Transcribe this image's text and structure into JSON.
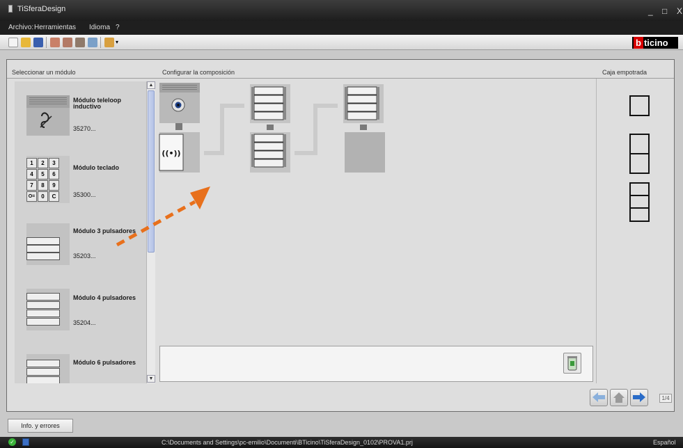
{
  "window": {
    "title": "TiSferaDesign",
    "controls": {
      "minimize": "_",
      "maximize": "□",
      "close": "X"
    }
  },
  "menu": [
    "Archivo:",
    "Herramientas",
    "Idioma",
    "?"
  ],
  "logo": {
    "prefix": "b",
    "rest": "ticino"
  },
  "headers": {
    "left": "Seleccionar un módulo",
    "center": "Configurar la composición",
    "right": "Caja empotrada"
  },
  "modules": [
    {
      "name": "Módulo teleloop inductivo",
      "code": "35270..."
    },
    {
      "name": "Módulo teclado",
      "code": "35300..."
    },
    {
      "name": "Módulo 3 pulsadores",
      "code": "35203..."
    },
    {
      "name": "Módulo 4 pulsadores",
      "code": "35204..."
    },
    {
      "name": "Módulo 6 pulsadores",
      "code": ""
    }
  ],
  "keypad": [
    "1",
    "2",
    "3",
    "4",
    "5",
    "6",
    "7",
    "8",
    "9",
    "O=",
    "0",
    "C"
  ],
  "page_indicator": "1/4",
  "info_button": "Info. y errores",
  "status": {
    "path": "C:\\Documents and Settings\\pc-emilio\\Documenti\\BTicino\\TiSferaDesign_0102\\PROVA1.prj",
    "language": "Español"
  },
  "colors": {
    "arrow": "#e8701c",
    "connector": "#c8c8c8",
    "module_gray": "#b3b3b3"
  }
}
